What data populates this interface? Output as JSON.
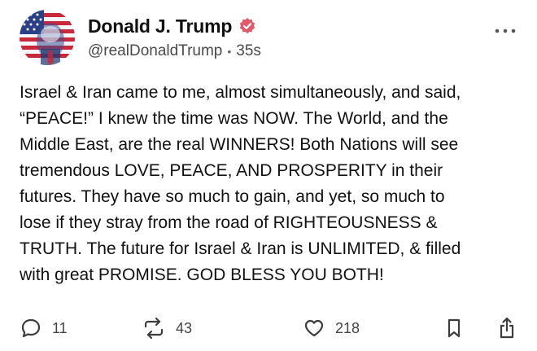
{
  "post": {
    "author": {
      "display_name": "Donald J. Trump",
      "handle": "@realDonaldTrump",
      "time_ago": "35s",
      "verified": true,
      "avatar_icon": "flag-portrait-avatar",
      "verified_icon": "verified-badge-icon"
    },
    "more_icon": "more-horizontal-icon",
    "body_lines": [
      "Israel & Iran came to me, almost simultaneously, and said,",
      "“PEACE!” I knew the time was NOW. The World, and the",
      "Middle East, are the real WINNERS! Both Nations will see",
      "tremendous LOVE, PEACE, AND PROSPERITY in their",
      "futures. They have so much to gain, and yet, so much to",
      "lose if they stray from the road of RIGHTEOUSNESS &",
      "TRUTH. The future for Israel & Iran is UNLIMITED, & filled",
      "with great PROMISE. GOD BLESS YOU BOTH!"
    ],
    "actions": {
      "reply": {
        "count": "11",
        "icon": "comment-icon"
      },
      "repost": {
        "count": "43",
        "icon": "repost-icon"
      },
      "like": {
        "count": "218",
        "icon": "heart-icon"
      },
      "bookmark": {
        "icon": "bookmark-icon"
      },
      "share": {
        "icon": "share-icon"
      }
    }
  },
  "colors": {
    "verified_badge": "#e05a6a",
    "text_primary": "#111111",
    "text_secondary": "#4a4a4a",
    "icon": "#3c3c3c"
  }
}
